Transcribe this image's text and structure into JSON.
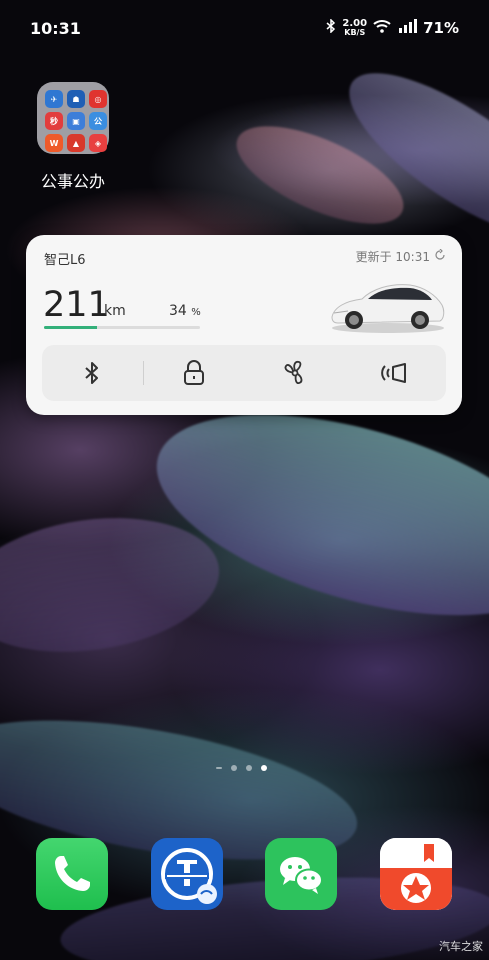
{
  "status_bar": {
    "time": "10:31",
    "net_speed_value": "2.00",
    "net_speed_unit": "KB/S",
    "battery": "71%"
  },
  "folder": {
    "label": "公事公办"
  },
  "widget": {
    "car_name": "智己L6",
    "update_text": "更新于 10:31",
    "range_value": "211",
    "range_unit": "km",
    "battery_percent": "34",
    "battery_percent_sign": "%",
    "battery_level": 0.34,
    "accent_color": "#33b07a",
    "controls": [
      "bluetooth-icon",
      "lock-icon",
      "fan-icon",
      "horn-icon"
    ]
  },
  "pager": {
    "pages": 4,
    "current": 4
  },
  "dock": {
    "apps": [
      "phone",
      "railway-12306",
      "wechat",
      "tomato-novel"
    ]
  },
  "watermark": "汽车之家"
}
